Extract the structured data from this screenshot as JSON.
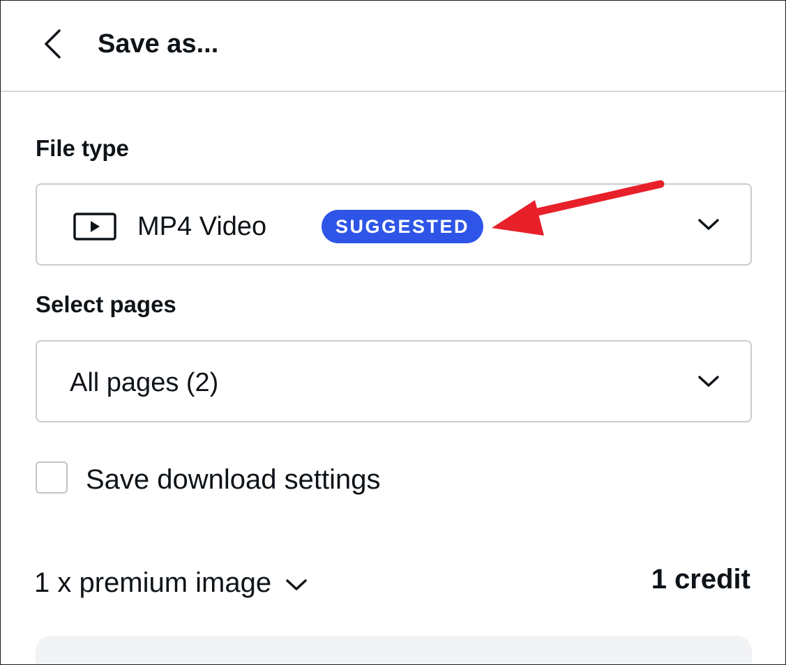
{
  "header": {
    "title": "Save as...",
    "back_icon": "chevron-left-icon"
  },
  "file_type": {
    "label": "File type",
    "value": "MP4 Video",
    "icon": "video-play-icon",
    "badge": "SUGGESTED",
    "badge_color": "#2e55e8"
  },
  "select_pages": {
    "label": "Select pages",
    "value": "All pages (2)"
  },
  "save_settings": {
    "label": "Save download settings",
    "checked": false
  },
  "premium": {
    "label": "1 x premium image",
    "cost": "1 credit"
  },
  "annotation": {
    "type": "arrow",
    "color": "#e8202a",
    "points_to": "badge"
  }
}
